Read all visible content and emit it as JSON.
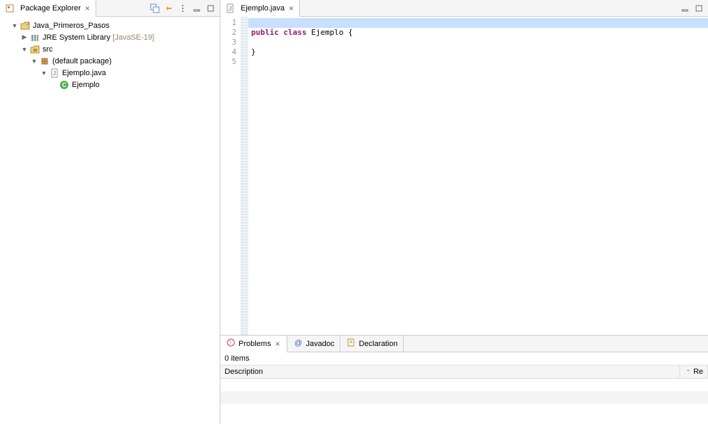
{
  "packageExplorer": {
    "title": "Package Explorer",
    "tree": {
      "project": "Java_Primeros_Pasos",
      "jre": "JRE System Library",
      "jreVersion": "[JavaSE-19]",
      "src": "src",
      "defaultPackage": "(default package)",
      "compilationUnit": "Ejemplo.java",
      "class": "Ejemplo"
    }
  },
  "editor": {
    "tabTitle": "Ejemplo.java",
    "lines": [
      "1",
      "2",
      "3",
      "4",
      "5"
    ],
    "code": {
      "line1": "",
      "line2_kw1": "public",
      "line2_kw2": "class",
      "line2_rest": " Ejemplo {",
      "line3": "",
      "line4": "}",
      "line5": ""
    }
  },
  "bottom": {
    "tabs": {
      "problems": "Problems",
      "javadoc": "Javadoc",
      "declaration": "Declaration"
    },
    "itemsCount": "0 items",
    "columns": {
      "description": "Description",
      "resource": "Re"
    }
  }
}
